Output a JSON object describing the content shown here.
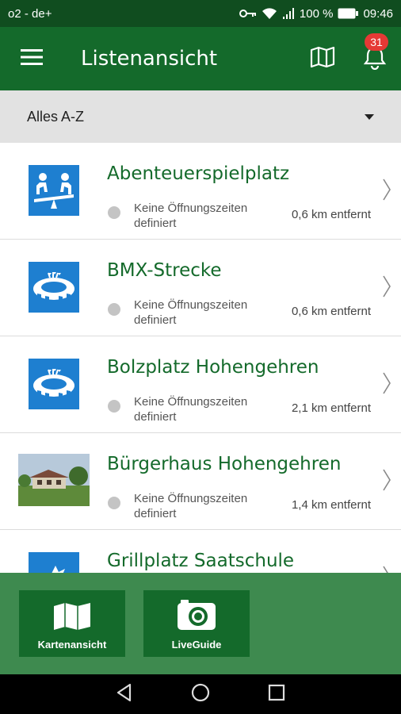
{
  "status": {
    "carrier": "o2 - de+",
    "battery": "100 %",
    "time": "09:46"
  },
  "appbar": {
    "title": "Listenansicht",
    "notifications_count": "31"
  },
  "sort": {
    "value": "Alles A-Z"
  },
  "list": [
    {
      "name": "Abenteuerspielplatz",
      "hours": "Keine Öffnungszeiten definiert",
      "distance": "0,6 km entfernt",
      "icon": "playground-icon"
    },
    {
      "name": "BMX-Strecke",
      "hours": "Keine Öffnungszeiten definiert",
      "distance": "0,6 km entfernt",
      "icon": "stadium-icon"
    },
    {
      "name": "Bolzplatz Hohengehren",
      "hours": "Keine Öffnungszeiten definiert",
      "distance": "2,1 km entfernt",
      "icon": "stadium-icon"
    },
    {
      "name": "Bürgerhaus Hohengehren",
      "hours": "Keine Öffnungszeiten definiert",
      "distance": "1,4 km entfernt",
      "icon": "building-photo"
    },
    {
      "name": "Grillplatz Saatschule",
      "hours": "",
      "distance": "",
      "icon": "grill-icon"
    }
  ],
  "bottom": {
    "map_label": "Kartenansicht",
    "liveguide_label": "LiveGuide"
  },
  "colors": {
    "appbar": "#146a2b",
    "statusbar": "#104d1f",
    "bottom_panel": "#3e8a4f",
    "title_text": "#146a2b"
  }
}
